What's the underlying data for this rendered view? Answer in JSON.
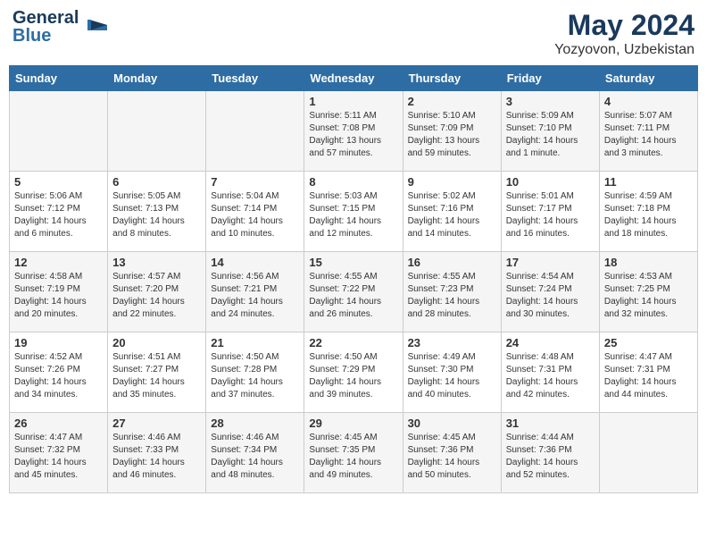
{
  "header": {
    "logo_line1": "General",
    "logo_line2": "Blue",
    "title": "May 2024",
    "subtitle": "Yozyovon, Uzbekistan"
  },
  "days_of_week": [
    "Sunday",
    "Monday",
    "Tuesday",
    "Wednesday",
    "Thursday",
    "Friday",
    "Saturday"
  ],
  "weeks": [
    [
      {
        "day": "",
        "sunrise": "",
        "sunset": "",
        "daylight": ""
      },
      {
        "day": "",
        "sunrise": "",
        "sunset": "",
        "daylight": ""
      },
      {
        "day": "",
        "sunrise": "",
        "sunset": "",
        "daylight": ""
      },
      {
        "day": "1",
        "sunrise": "Sunrise: 5:11 AM",
        "sunset": "Sunset: 7:08 PM",
        "daylight": "Daylight: 13 hours and 57 minutes."
      },
      {
        "day": "2",
        "sunrise": "Sunrise: 5:10 AM",
        "sunset": "Sunset: 7:09 PM",
        "daylight": "Daylight: 13 hours and 59 minutes."
      },
      {
        "day": "3",
        "sunrise": "Sunrise: 5:09 AM",
        "sunset": "Sunset: 7:10 PM",
        "daylight": "Daylight: 14 hours and 1 minute."
      },
      {
        "day": "4",
        "sunrise": "Sunrise: 5:07 AM",
        "sunset": "Sunset: 7:11 PM",
        "daylight": "Daylight: 14 hours and 3 minutes."
      }
    ],
    [
      {
        "day": "5",
        "sunrise": "Sunrise: 5:06 AM",
        "sunset": "Sunset: 7:12 PM",
        "daylight": "Daylight: 14 hours and 6 minutes."
      },
      {
        "day": "6",
        "sunrise": "Sunrise: 5:05 AM",
        "sunset": "Sunset: 7:13 PM",
        "daylight": "Daylight: 14 hours and 8 minutes."
      },
      {
        "day": "7",
        "sunrise": "Sunrise: 5:04 AM",
        "sunset": "Sunset: 7:14 PM",
        "daylight": "Daylight: 14 hours and 10 minutes."
      },
      {
        "day": "8",
        "sunrise": "Sunrise: 5:03 AM",
        "sunset": "Sunset: 7:15 PM",
        "daylight": "Daylight: 14 hours and 12 minutes."
      },
      {
        "day": "9",
        "sunrise": "Sunrise: 5:02 AM",
        "sunset": "Sunset: 7:16 PM",
        "daylight": "Daylight: 14 hours and 14 minutes."
      },
      {
        "day": "10",
        "sunrise": "Sunrise: 5:01 AM",
        "sunset": "Sunset: 7:17 PM",
        "daylight": "Daylight: 14 hours and 16 minutes."
      },
      {
        "day": "11",
        "sunrise": "Sunrise: 4:59 AM",
        "sunset": "Sunset: 7:18 PM",
        "daylight": "Daylight: 14 hours and 18 minutes."
      }
    ],
    [
      {
        "day": "12",
        "sunrise": "Sunrise: 4:58 AM",
        "sunset": "Sunset: 7:19 PM",
        "daylight": "Daylight: 14 hours and 20 minutes."
      },
      {
        "day": "13",
        "sunrise": "Sunrise: 4:57 AM",
        "sunset": "Sunset: 7:20 PM",
        "daylight": "Daylight: 14 hours and 22 minutes."
      },
      {
        "day": "14",
        "sunrise": "Sunrise: 4:56 AM",
        "sunset": "Sunset: 7:21 PM",
        "daylight": "Daylight: 14 hours and 24 minutes."
      },
      {
        "day": "15",
        "sunrise": "Sunrise: 4:55 AM",
        "sunset": "Sunset: 7:22 PM",
        "daylight": "Daylight: 14 hours and 26 minutes."
      },
      {
        "day": "16",
        "sunrise": "Sunrise: 4:55 AM",
        "sunset": "Sunset: 7:23 PM",
        "daylight": "Daylight: 14 hours and 28 minutes."
      },
      {
        "day": "17",
        "sunrise": "Sunrise: 4:54 AM",
        "sunset": "Sunset: 7:24 PM",
        "daylight": "Daylight: 14 hours and 30 minutes."
      },
      {
        "day": "18",
        "sunrise": "Sunrise: 4:53 AM",
        "sunset": "Sunset: 7:25 PM",
        "daylight": "Daylight: 14 hours and 32 minutes."
      }
    ],
    [
      {
        "day": "19",
        "sunrise": "Sunrise: 4:52 AM",
        "sunset": "Sunset: 7:26 PM",
        "daylight": "Daylight: 14 hours and 34 minutes."
      },
      {
        "day": "20",
        "sunrise": "Sunrise: 4:51 AM",
        "sunset": "Sunset: 7:27 PM",
        "daylight": "Daylight: 14 hours and 35 minutes."
      },
      {
        "day": "21",
        "sunrise": "Sunrise: 4:50 AM",
        "sunset": "Sunset: 7:28 PM",
        "daylight": "Daylight: 14 hours and 37 minutes."
      },
      {
        "day": "22",
        "sunrise": "Sunrise: 4:50 AM",
        "sunset": "Sunset: 7:29 PM",
        "daylight": "Daylight: 14 hours and 39 minutes."
      },
      {
        "day": "23",
        "sunrise": "Sunrise: 4:49 AM",
        "sunset": "Sunset: 7:30 PM",
        "daylight": "Daylight: 14 hours and 40 minutes."
      },
      {
        "day": "24",
        "sunrise": "Sunrise: 4:48 AM",
        "sunset": "Sunset: 7:31 PM",
        "daylight": "Daylight: 14 hours and 42 minutes."
      },
      {
        "day": "25",
        "sunrise": "Sunrise: 4:47 AM",
        "sunset": "Sunset: 7:31 PM",
        "daylight": "Daylight: 14 hours and 44 minutes."
      }
    ],
    [
      {
        "day": "26",
        "sunrise": "Sunrise: 4:47 AM",
        "sunset": "Sunset: 7:32 PM",
        "daylight": "Daylight: 14 hours and 45 minutes."
      },
      {
        "day": "27",
        "sunrise": "Sunrise: 4:46 AM",
        "sunset": "Sunset: 7:33 PM",
        "daylight": "Daylight: 14 hours and 46 minutes."
      },
      {
        "day": "28",
        "sunrise": "Sunrise: 4:46 AM",
        "sunset": "Sunset: 7:34 PM",
        "daylight": "Daylight: 14 hours and 48 minutes."
      },
      {
        "day": "29",
        "sunrise": "Sunrise: 4:45 AM",
        "sunset": "Sunset: 7:35 PM",
        "daylight": "Daylight: 14 hours and 49 minutes."
      },
      {
        "day": "30",
        "sunrise": "Sunrise: 4:45 AM",
        "sunset": "Sunset: 7:36 PM",
        "daylight": "Daylight: 14 hours and 50 minutes."
      },
      {
        "day": "31",
        "sunrise": "Sunrise: 4:44 AM",
        "sunset": "Sunset: 7:36 PM",
        "daylight": "Daylight: 14 hours and 52 minutes."
      },
      {
        "day": "",
        "sunrise": "",
        "sunset": "",
        "daylight": ""
      }
    ]
  ]
}
